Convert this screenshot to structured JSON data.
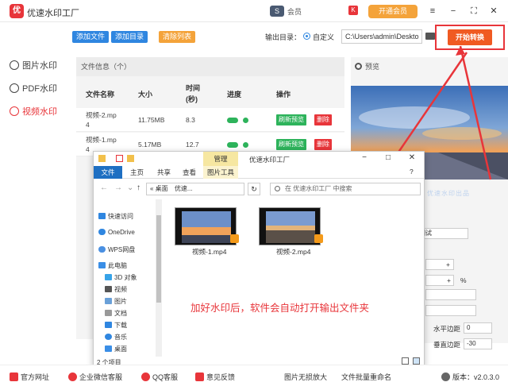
{
  "app": {
    "title": "优速水印工厂",
    "logo_text": "优",
    "account_text": "会员",
    "account_badge": "K",
    "vip_label": "开通会员",
    "window_controls": [
      "≡",
      "−",
      "⛶",
      "✕"
    ]
  },
  "sidebar": {
    "items": [
      {
        "label": "图片水印",
        "active": false
      },
      {
        "label": "PDF水印",
        "active": false
      },
      {
        "label": "视频水印",
        "active": true
      }
    ]
  },
  "toolbar": {
    "add_file": "添加文件",
    "add_dir": "添加目录",
    "clear_list": "清除列表",
    "output_label": "输出目录：",
    "radio_label": "自定义",
    "output_path": "C:\\Users\\admin\\Deskto",
    "start_label": "开始转换"
  },
  "file_panel": {
    "header": "文件信息（个）",
    "columns": [
      "文件名称",
      "大小",
      "时间\n(秒)",
      "进度",
      "操作"
    ],
    "col_time_a": "时间",
    "col_time_b": "(秒)",
    "rows": [
      {
        "name_a": "视频-2.mp",
        "name_b": "4",
        "size": "11.75MB",
        "time": "8.3",
        "preview": "刷新预览",
        "delete": "删除"
      },
      {
        "name_a": "视频-1.mp",
        "name_b": "4",
        "size": "5.17MB",
        "time": "12.7",
        "preview": "刷新预览",
        "delete": "删除"
      }
    ]
  },
  "preview": {
    "header": "预览",
    "watermark": "优速水印出品"
  },
  "settings": {
    "text_value": "测试",
    "plus": "+",
    "percent": "%",
    "h_margin_label": "水平边距",
    "h_margin_value": "0",
    "v_margin_label": "垂直边距",
    "v_margin_value": "-30"
  },
  "explorer": {
    "manage_tab": "管理",
    "window_title": "优速水印工厂",
    "ribbon_tabs": {
      "file": "文件",
      "home": "主页",
      "share": "共享",
      "view": "查看",
      "tools": "图片工具"
    },
    "address_a": "« 桌面",
    "address_b": "优速...",
    "search_placeholder": "在 优速水印工厂 中搜索",
    "nav": [
      "快速访问",
      "OneDrive",
      "WPS网盘",
      "此电脑",
      "3D 对象",
      "视频",
      "图片",
      "文档",
      "下载",
      "音乐",
      "桌面"
    ],
    "files": [
      {
        "name": "视频-1.mp4"
      },
      {
        "name": "视频-2.mp4"
      }
    ],
    "status": "2 个项目",
    "annotation": "加好水印后，软件会自动打开输出文件夹"
  },
  "bottom": {
    "items": [
      "官方网址",
      "企业微信客服",
      "QQ客服",
      "意见反馈",
      "图片无损放大",
      "文件批量重命名"
    ],
    "version": "版本：v2.0.3.0"
  },
  "colors": {
    "accent_red": "#e8353a",
    "blue": "#2f86e0",
    "orange": "#f4a33a",
    "green": "#2db35b",
    "start_orange": "#f05a22"
  }
}
